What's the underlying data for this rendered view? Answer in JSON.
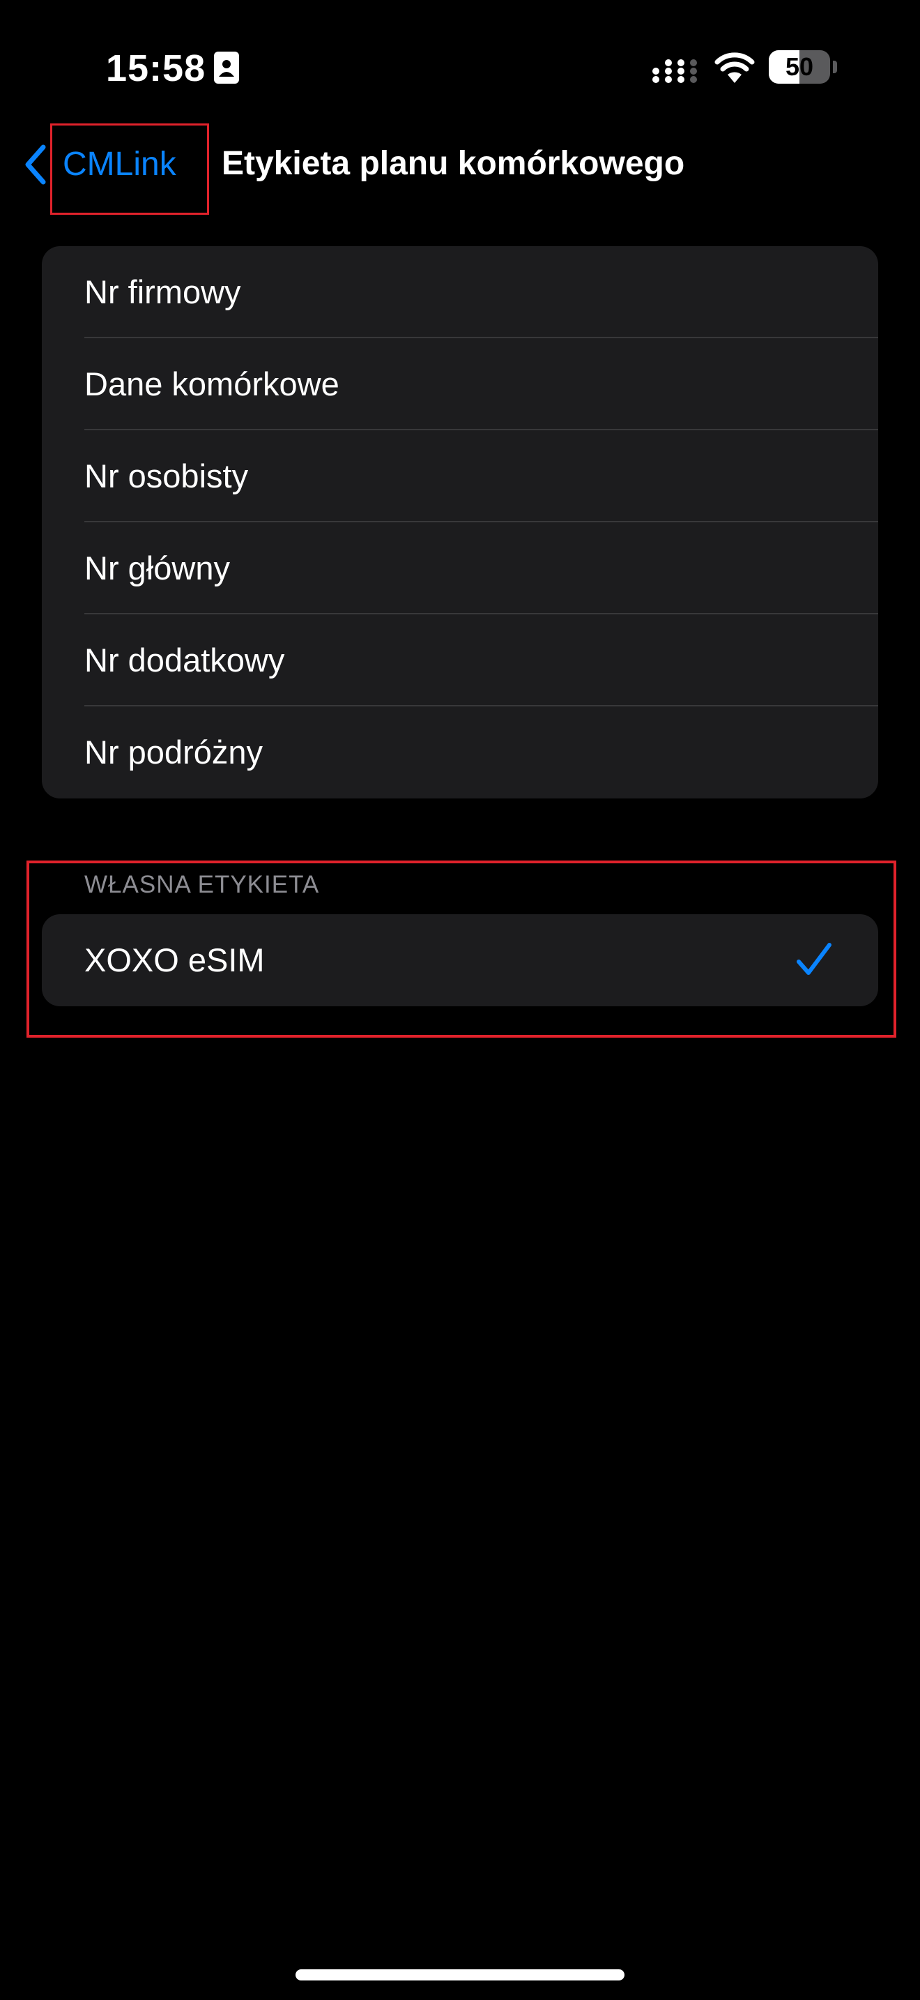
{
  "status_bar": {
    "time": "15:58",
    "battery_level": "50",
    "battery_fraction": 0.5,
    "id_icon": "person-card-icon",
    "signal_icon": "cellular-signal-icon",
    "wifi_icon": "wifi-icon"
  },
  "nav": {
    "back_label": "CMLink",
    "back_icon": "chevron-left-icon",
    "title": "Etykieta planu komórkowego"
  },
  "options": [
    {
      "label": "Nr firmowy"
    },
    {
      "label": "Dane komórkowe"
    },
    {
      "label": "Nr osobisty"
    },
    {
      "label": "Nr główny"
    },
    {
      "label": "Nr dodatkowy"
    },
    {
      "label": "Nr podróżny"
    }
  ],
  "custom_section": {
    "header": "WŁASNA ETYKIETA",
    "value": "XOXO eSIM",
    "selected": true,
    "check_icon": "checkmark-icon"
  },
  "colors": {
    "background": "#000000",
    "cell_background": "#1c1c1e",
    "accent": "#0a84ff",
    "highlight": "#e0222b",
    "secondary_text": "#8d8d93"
  }
}
